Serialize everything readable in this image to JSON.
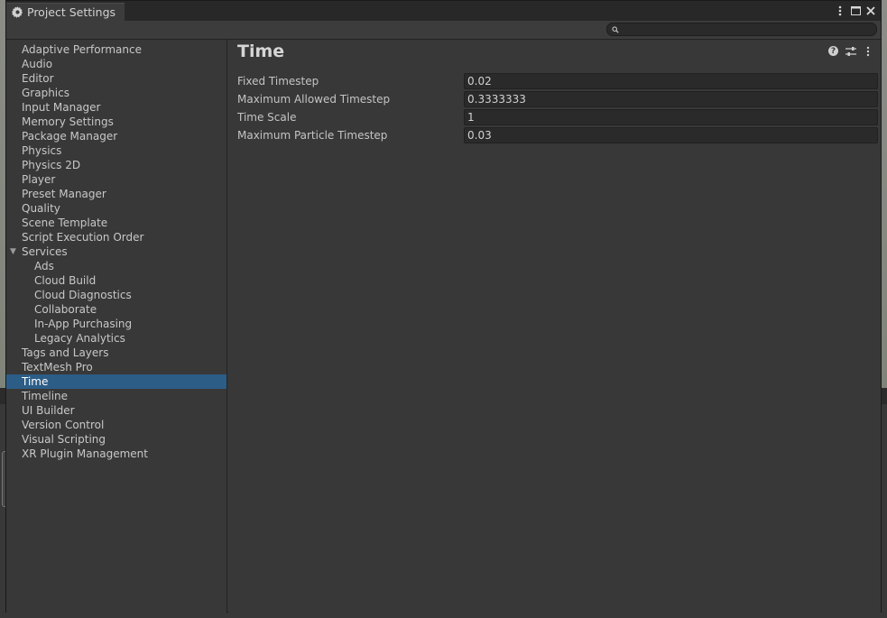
{
  "window": {
    "tab_title": "Project Settings"
  },
  "search": {
    "placeholder": "",
    "value": ""
  },
  "sidebar": {
    "items": [
      {
        "label": "Adaptive Performance"
      },
      {
        "label": "Audio"
      },
      {
        "label": "Editor"
      },
      {
        "label": "Graphics"
      },
      {
        "label": "Input Manager"
      },
      {
        "label": "Memory Settings"
      },
      {
        "label": "Package Manager"
      },
      {
        "label": "Physics"
      },
      {
        "label": "Physics 2D"
      },
      {
        "label": "Player"
      },
      {
        "label": "Preset Manager"
      },
      {
        "label": "Quality"
      },
      {
        "label": "Scene Template"
      },
      {
        "label": "Script Execution Order"
      },
      {
        "label": "Services",
        "expanded": true
      },
      {
        "label": "Ads",
        "child": true
      },
      {
        "label": "Cloud Build",
        "child": true
      },
      {
        "label": "Cloud Diagnostics",
        "child": true
      },
      {
        "label": "Collaborate",
        "child": true
      },
      {
        "label": "In-App Purchasing",
        "child": true
      },
      {
        "label": "Legacy Analytics",
        "child": true
      },
      {
        "label": "Tags and Layers"
      },
      {
        "label": "TextMesh Pro"
      },
      {
        "label": "Time",
        "selected": true
      },
      {
        "label": "Timeline"
      },
      {
        "label": "UI Builder"
      },
      {
        "label": "Version Control"
      },
      {
        "label": "Visual Scripting"
      },
      {
        "label": "XR Plugin Management"
      }
    ]
  },
  "main": {
    "title": "Time",
    "fields": [
      {
        "label": "Fixed Timestep",
        "value": "0.02"
      },
      {
        "label": "Maximum Allowed Timestep",
        "value": "0.3333333"
      },
      {
        "label": "Time Scale",
        "value": "1"
      },
      {
        "label": "Maximum Particle Timestep",
        "value": "0.03"
      }
    ]
  },
  "colors": {
    "selection": "#2c5d87",
    "panel": "#383838",
    "titlebar": "#282828"
  }
}
